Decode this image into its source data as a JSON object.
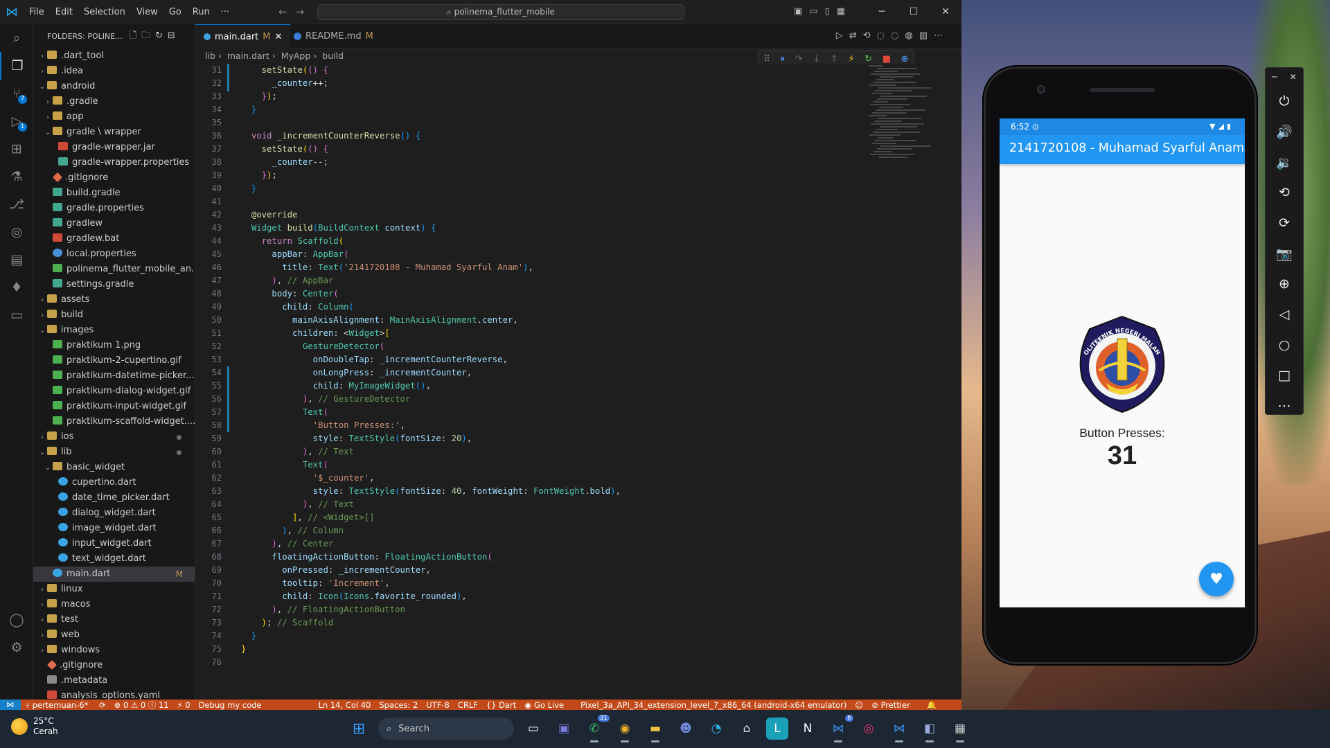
{
  "menu": [
    "File",
    "Edit",
    "Selection",
    "View",
    "Go",
    "Run",
    "···"
  ],
  "window": {
    "search_text": "polinema_flutter_mobile"
  },
  "explorer": {
    "title": "FOLDERS: POLINE...",
    "items": [
      {
        "label": ".dart_tool",
        "indent": 0,
        "kind": "folder",
        "chev": "›"
      },
      {
        "label": ".idea",
        "indent": 0,
        "kind": "folder",
        "chev": "›"
      },
      {
        "label": "android",
        "indent": 0,
        "kind": "folder",
        "chev": "⌄"
      },
      {
        "label": ".gradle",
        "indent": 1,
        "kind": "folder",
        "chev": "›"
      },
      {
        "label": "app",
        "indent": 1,
        "kind": "folder",
        "chev": "›"
      },
      {
        "label": "gradle \\ wrapper",
        "indent": 1,
        "kind": "folder",
        "chev": "⌄"
      },
      {
        "label": "gradle-wrapper.jar",
        "indent": 2,
        "kind": "jar",
        "chev": ""
      },
      {
        "label": "gradle-wrapper.properties",
        "indent": 2,
        "kind": "grad",
        "chev": ""
      },
      {
        "label": ".gitignore",
        "indent": 1,
        "kind": "git",
        "chev": ""
      },
      {
        "label": "build.gradle",
        "indent": 1,
        "kind": "grad",
        "chev": ""
      },
      {
        "label": "gradle.properties",
        "indent": 1,
        "kind": "grad",
        "chev": ""
      },
      {
        "label": "gradlew",
        "indent": 1,
        "kind": "grad",
        "chev": ""
      },
      {
        "label": "gradlew.bat",
        "indent": 1,
        "kind": "jar",
        "chev": ""
      },
      {
        "label": "local.properties",
        "indent": 1,
        "kind": "gear",
        "chev": ""
      },
      {
        "label": "polinema_flutter_mobile_an...",
        "indent": 1,
        "kind": "img",
        "chev": ""
      },
      {
        "label": "settings.gradle",
        "indent": 1,
        "kind": "grad",
        "chev": ""
      },
      {
        "label": "assets",
        "indent": 0,
        "kind": "folder",
        "chev": "›"
      },
      {
        "label": "build",
        "indent": 0,
        "kind": "folder",
        "chev": "›"
      },
      {
        "label": "images",
        "indent": 0,
        "kind": "folder",
        "chev": "⌄"
      },
      {
        "label": "praktikum 1.png",
        "indent": 1,
        "kind": "img",
        "chev": ""
      },
      {
        "label": "praktikum-2-cupertino.gif",
        "indent": 1,
        "kind": "img",
        "chev": ""
      },
      {
        "label": "praktikum-datetime-picker...",
        "indent": 1,
        "kind": "img",
        "chev": ""
      },
      {
        "label": "praktikum-dialog-widget.gif",
        "indent": 1,
        "kind": "img",
        "chev": ""
      },
      {
        "label": "praktikum-input-widget.gif",
        "indent": 1,
        "kind": "img",
        "chev": ""
      },
      {
        "label": "praktikum-scaffold-widget....",
        "indent": 1,
        "kind": "img",
        "chev": ""
      },
      {
        "label": "ios",
        "indent": 0,
        "kind": "folder",
        "chev": "›"
      },
      {
        "label": "lib",
        "indent": 0,
        "kind": "folder",
        "chev": "⌄"
      },
      {
        "label": "basic_widget",
        "indent": 1,
        "kind": "folder",
        "chev": "⌄"
      },
      {
        "label": "cupertino.dart",
        "indent": 2,
        "kind": "dart",
        "chev": ""
      },
      {
        "label": "date_time_picker.dart",
        "indent": 2,
        "kind": "dart",
        "chev": ""
      },
      {
        "label": "dialog_widget.dart",
        "indent": 2,
        "kind": "dart",
        "chev": ""
      },
      {
        "label": "image_widget.dart",
        "indent": 2,
        "kind": "dart",
        "chev": ""
      },
      {
        "label": "input_widget.dart",
        "indent": 2,
        "kind": "dart",
        "chev": ""
      },
      {
        "label": "text_widget.dart",
        "indent": 2,
        "kind": "dart",
        "chev": ""
      },
      {
        "label": "main.dart",
        "indent": 1,
        "kind": "dart",
        "chev": "",
        "tail": "M",
        "selected": true
      },
      {
        "label": "linux",
        "indent": 0,
        "kind": "folder",
        "chev": "›"
      },
      {
        "label": "macos",
        "indent": 0,
        "kind": "folder",
        "chev": "›"
      },
      {
        "label": "test",
        "indent": 0,
        "kind": "folder",
        "chev": "›"
      },
      {
        "label": "web",
        "indent": 0,
        "kind": "folder",
        "chev": "›"
      },
      {
        "label": "windows",
        "indent": 0,
        "kind": "folder",
        "chev": "›"
      },
      {
        "label": ".gitignore",
        "indent": 0,
        "kind": "git",
        "chev": ""
      },
      {
        "label": ".metadata",
        "indent": 0,
        "kind": "file",
        "chev": ""
      },
      {
        "label": "analysis_options.yaml",
        "indent": 0,
        "kind": "jar",
        "chev": ""
      }
    ]
  },
  "tabs": [
    {
      "label": "main.dart",
      "modified": "M",
      "active": true
    },
    {
      "label": "README.md",
      "modified": "M",
      "active": false
    }
  ],
  "breadcrumb": [
    "lib",
    "main.dart",
    "MyApp",
    "build"
  ],
  "editor": {
    "line_numbers": [
      "31",
      "32",
      "33",
      "34",
      "35",
      "36",
      "37",
      "38",
      "39",
      "40",
      "41",
      "42",
      "43",
      "44",
      "45",
      "46",
      "47",
      "48",
      "49",
      "50",
      "51",
      "52",
      "53",
      "54",
      "55",
      "56",
      "57",
      "58",
      "59",
      "60",
      "61",
      "62",
      "63",
      "64",
      "65",
      "66",
      "67",
      "68",
      "69",
      "70",
      "71",
      "72",
      "73",
      "74",
      "75",
      "76"
    ],
    "lines": [
      [
        [
          "pl",
          "    "
        ],
        [
          "fn",
          "setState"
        ],
        [
          "br1",
          "("
        ],
        [
          "br2",
          "()"
        ],
        [
          "pl",
          " "
        ],
        [
          "br2",
          "{"
        ]
      ],
      [
        [
          "pl",
          "      "
        ],
        [
          "vr",
          "_counter"
        ],
        [
          "pl",
          "++;"
        ]
      ],
      [
        [
          "pl",
          "    "
        ],
        [
          "br2",
          "}"
        ],
        [
          "br1",
          ")"
        ],
        [
          "pl",
          ";"
        ]
      ],
      [
        [
          "pl",
          "  "
        ],
        [
          "br3",
          "}"
        ]
      ],
      [
        [
          "pl",
          ""
        ]
      ],
      [
        [
          "pl",
          "  "
        ],
        [
          "kw",
          "void"
        ],
        [
          "pl",
          " "
        ],
        [
          "fn",
          "_incrementCounterReverse"
        ],
        [
          "br3",
          "()"
        ],
        [
          "pl",
          " "
        ],
        [
          "br3",
          "{"
        ]
      ],
      [
        [
          "pl",
          "    "
        ],
        [
          "fn",
          "setState"
        ],
        [
          "br1",
          "("
        ],
        [
          "br2",
          "()"
        ],
        [
          "pl",
          " "
        ],
        [
          "br2",
          "{"
        ]
      ],
      [
        [
          "pl",
          "      "
        ],
        [
          "vr",
          "_counter"
        ],
        [
          "pl",
          "--;"
        ]
      ],
      [
        [
          "pl",
          "    "
        ],
        [
          "br2",
          "}"
        ],
        [
          "br1",
          ")"
        ],
        [
          "pl",
          ";"
        ]
      ],
      [
        [
          "pl",
          "  "
        ],
        [
          "br3",
          "}"
        ]
      ],
      [
        [
          "pl",
          ""
        ]
      ],
      [
        [
          "pl",
          "  "
        ],
        [
          "an",
          "@override"
        ]
      ],
      [
        [
          "pl",
          "  "
        ],
        [
          "ty",
          "Widget"
        ],
        [
          "pl",
          " "
        ],
        [
          "fn",
          "build"
        ],
        [
          "br3",
          "("
        ],
        [
          "ty",
          "BuildContext"
        ],
        [
          "pl",
          " "
        ],
        [
          "vr",
          "context"
        ],
        [
          "br3",
          ")"
        ],
        [
          "pl",
          " "
        ],
        [
          "br3",
          "{"
        ]
      ],
      [
        [
          "pl",
          "    "
        ],
        [
          "kw",
          "return"
        ],
        [
          "pl",
          " "
        ],
        [
          "ty",
          "Scaffold"
        ],
        [
          "br1",
          "("
        ]
      ],
      [
        [
          "pl",
          "      "
        ],
        [
          "vr",
          "appBar"
        ],
        [
          "pl",
          ": "
        ],
        [
          "ty",
          "AppBar"
        ],
        [
          "br2",
          "("
        ]
      ],
      [
        [
          "pl",
          "        "
        ],
        [
          "vr",
          "title"
        ],
        [
          "pl",
          ": "
        ],
        [
          "ty",
          "Text"
        ],
        [
          "br3",
          "("
        ],
        [
          "str",
          "'2141720108 - Muhamad Syarful Anam'"
        ],
        [
          "br3",
          ")"
        ],
        [
          "pl",
          ","
        ]
      ],
      [
        [
          "pl",
          "      "
        ],
        [
          "br2",
          ")"
        ],
        [
          "pl",
          ", "
        ],
        [
          "cm",
          "// AppBar"
        ]
      ],
      [
        [
          "pl",
          "      "
        ],
        [
          "vr",
          "body"
        ],
        [
          "pl",
          ": "
        ],
        [
          "ty",
          "Center"
        ],
        [
          "br2",
          "("
        ]
      ],
      [
        [
          "pl",
          "        "
        ],
        [
          "vr",
          "child"
        ],
        [
          "pl",
          ": "
        ],
        [
          "ty",
          "Column"
        ],
        [
          "br3",
          "("
        ]
      ],
      [
        [
          "pl",
          "          "
        ],
        [
          "vr",
          "mainAxisAlignment"
        ],
        [
          "pl",
          ": "
        ],
        [
          "ty",
          "MainAxisAlignment"
        ],
        [
          "pl",
          "."
        ],
        [
          "vr",
          "center"
        ],
        [
          "pl",
          ","
        ]
      ],
      [
        [
          "pl",
          "          "
        ],
        [
          "vr",
          "children"
        ],
        [
          "pl",
          ": <"
        ],
        [
          "ty",
          "Widget"
        ],
        [
          "pl",
          ">"
        ],
        [
          "br1",
          "["
        ]
      ],
      [
        [
          "pl",
          "            "
        ],
        [
          "ty",
          "GestureDetector"
        ],
        [
          "br2",
          "("
        ]
      ],
      [
        [
          "pl",
          "              "
        ],
        [
          "vr",
          "onDoubleTap"
        ],
        [
          "pl",
          ": "
        ],
        [
          "vr",
          "_incrementCounterReverse"
        ],
        [
          "pl",
          ","
        ]
      ],
      [
        [
          "pl",
          "              "
        ],
        [
          "vr",
          "onLongPress"
        ],
        [
          "pl",
          ": "
        ],
        [
          "vr",
          "_incrementCounter"
        ],
        [
          "pl",
          ","
        ]
      ],
      [
        [
          "pl",
          "              "
        ],
        [
          "vr",
          "child"
        ],
        [
          "pl",
          ": "
        ],
        [
          "ty",
          "MyImageWidget"
        ],
        [
          "br3",
          "()"
        ],
        [
          "pl",
          ","
        ]
      ],
      [
        [
          "pl",
          "            "
        ],
        [
          "br2",
          ")"
        ],
        [
          "pl",
          ", "
        ],
        [
          "cm",
          "// GestureDetector"
        ]
      ],
      [
        [
          "pl",
          "            "
        ],
        [
          "ty",
          "Text"
        ],
        [
          "br2",
          "("
        ]
      ],
      [
        [
          "pl",
          "              "
        ],
        [
          "str",
          "'Button Presses:'"
        ],
        [
          "pl",
          ","
        ]
      ],
      [
        [
          "pl",
          "              "
        ],
        [
          "vr",
          "style"
        ],
        [
          "pl",
          ": "
        ],
        [
          "ty",
          "TextStyle"
        ],
        [
          "br3",
          "("
        ],
        [
          "vr",
          "fontSize"
        ],
        [
          "pl",
          ": "
        ],
        [
          "num",
          "20"
        ],
        [
          "br3",
          ")"
        ],
        [
          "pl",
          ","
        ]
      ],
      [
        [
          "pl",
          "            "
        ],
        [
          "br2",
          ")"
        ],
        [
          "pl",
          ", "
        ],
        [
          "cm",
          "// Text"
        ]
      ],
      [
        [
          "pl",
          "            "
        ],
        [
          "ty",
          "Text"
        ],
        [
          "br2",
          "("
        ]
      ],
      [
        [
          "pl",
          "              "
        ],
        [
          "str",
          "'$_counter'"
        ],
        [
          "pl",
          ","
        ]
      ],
      [
        [
          "pl",
          "              "
        ],
        [
          "vr",
          "style"
        ],
        [
          "pl",
          ": "
        ],
        [
          "ty",
          "TextStyle"
        ],
        [
          "br3",
          "("
        ],
        [
          "vr",
          "fontSize"
        ],
        [
          "pl",
          ": "
        ],
        [
          "num",
          "40"
        ],
        [
          "pl",
          ", "
        ],
        [
          "vr",
          "fontWeight"
        ],
        [
          "pl",
          ": "
        ],
        [
          "ty",
          "FontWeight"
        ],
        [
          "pl",
          "."
        ],
        [
          "vr",
          "bold"
        ],
        [
          "br3",
          ")"
        ],
        [
          "pl",
          ","
        ]
      ],
      [
        [
          "pl",
          "            "
        ],
        [
          "br2",
          ")"
        ],
        [
          "pl",
          ", "
        ],
        [
          "cm",
          "// Text"
        ]
      ],
      [
        [
          "pl",
          "          "
        ],
        [
          "br1",
          "]"
        ],
        [
          "pl",
          ", "
        ],
        [
          "cm",
          "// <Widget>[]"
        ]
      ],
      [
        [
          "pl",
          "        "
        ],
        [
          "br3",
          ")"
        ],
        [
          "pl",
          ", "
        ],
        [
          "cm",
          "// Column"
        ]
      ],
      [
        [
          "pl",
          "      "
        ],
        [
          "br2",
          ")"
        ],
        [
          "pl",
          ", "
        ],
        [
          "cm",
          "// Center"
        ]
      ],
      [
        [
          "pl",
          "      "
        ],
        [
          "vr",
          "floatingActionButton"
        ],
        [
          "pl",
          ": "
        ],
        [
          "ty",
          "FloatingActionButton"
        ],
        [
          "br2",
          "("
        ]
      ],
      [
        [
          "pl",
          "        "
        ],
        [
          "vr",
          "onPressed"
        ],
        [
          "pl",
          ": "
        ],
        [
          "vr",
          "_incrementCounter"
        ],
        [
          "pl",
          ","
        ]
      ],
      [
        [
          "pl",
          "        "
        ],
        [
          "vr",
          "tooltip"
        ],
        [
          "pl",
          ": "
        ],
        [
          "str",
          "'Increment'"
        ],
        [
          "pl",
          ","
        ]
      ],
      [
        [
          "pl",
          "        "
        ],
        [
          "vr",
          "child"
        ],
        [
          "pl",
          ": "
        ],
        [
          "ty",
          "Icon"
        ],
        [
          "br3",
          "("
        ],
        [
          "ty",
          "Icons"
        ],
        [
          "pl",
          "."
        ],
        [
          "vr",
          "favorite_rounded"
        ],
        [
          "br3",
          ")"
        ],
        [
          "pl",
          ","
        ]
      ],
      [
        [
          "pl",
          "      "
        ],
        [
          "br2",
          ")"
        ],
        [
          "pl",
          ", "
        ],
        [
          "cm",
          "// FloatingActionButton"
        ]
      ],
      [
        [
          "pl",
          "    "
        ],
        [
          "br1",
          ")"
        ],
        [
          "pl",
          "; "
        ],
        [
          "cm",
          "// Scaffold"
        ]
      ],
      [
        [
          "pl",
          "  "
        ],
        [
          "br3",
          "}"
        ]
      ],
      [
        [
          "pl",
          ""
        ],
        [
          "br1",
          "}"
        ]
      ],
      [
        [
          "pl",
          ""
        ]
      ]
    ]
  },
  "statusbar": {
    "branch": "pertemuan-6*",
    "problems": "⊗ 0 ⚠ 0 ⓘ 11",
    "ports": "⚡ 0",
    "debug": "Debug my code",
    "position": "Ln 14, Col 40",
    "spaces": "Spaces: 2",
    "encoding": "UTF-8",
    "eol": "CRLF",
    "language": "{} Dart",
    "golive": "Go Live",
    "device": "Pixel_3a_API_34_extension_level_7_x86_64 (android-x64 emulator)",
    "prettier": "Prettier"
  },
  "phone": {
    "time": "6:52",
    "appbar_title": "2141720108 - Muhamad Syarful Anam",
    "logo_text": "POLITEKNIK NEGERI MALANG",
    "label": "Button Presses:",
    "counter": "31"
  },
  "taskbar": {
    "temp": "25°C",
    "weather": "Cerah",
    "search_placeholder": "Search"
  }
}
